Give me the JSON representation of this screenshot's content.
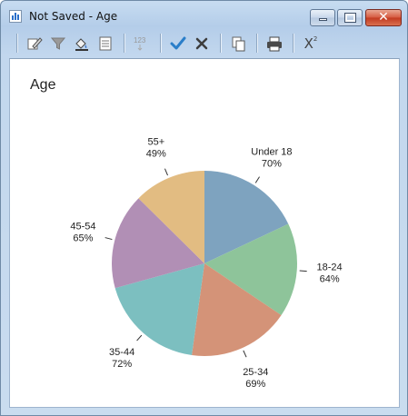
{
  "window": {
    "title": "Not Saved - Age",
    "icon": "bar-chart-icon"
  },
  "window_controls": [
    "minimize-icon",
    "maximize-icon",
    "close-icon"
  ],
  "toolbar": {
    "items": [
      "edit-chart-icon",
      "filter-icon",
      "fill-color-icon",
      "notes-icon",
      "number-format-icon",
      "checkmark-icon",
      "cross-icon",
      "copy-icon",
      "print-icon",
      "chi-square-icon"
    ],
    "number_format_label": "123",
    "chi_label": "X",
    "chi_super": "2"
  },
  "chart_data": {
    "type": "pie",
    "title": "Age",
    "categories": [
      "Under 18",
      "18-24",
      "25-34",
      "35-44",
      "45-54",
      "55+"
    ],
    "values": [
      70,
      64,
      69,
      72,
      65,
      49
    ],
    "labels": [
      "70%",
      "64%",
      "69%",
      "72%",
      "65%",
      "49%"
    ],
    "colors": [
      "#7ea3bf",
      "#8ec49a",
      "#d49378",
      "#7cbfc0",
      "#b18fb5",
      "#e2bc82"
    ],
    "start_angle": "12 o'clock",
    "direction": "clockwise",
    "legend": "none"
  }
}
